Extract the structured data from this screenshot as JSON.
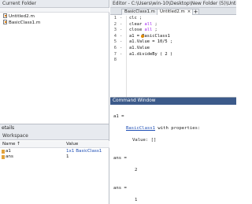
{
  "current_folder": {
    "title": "Current Folder",
    "files": [
      "Untitled2.m",
      "BasicClass1.m"
    ]
  },
  "details": {
    "label": "etails"
  },
  "workspace": {
    "title": "Workspace",
    "col_name": "Name ↑",
    "col_value": "Value",
    "vars": [
      {
        "name": "a1",
        "value": "1x1 BasicClass1"
      },
      {
        "name": "ans",
        "value": "1"
      }
    ]
  },
  "editor": {
    "title": "Editor - C:\\Users\\win-10\\Desktop\\New Folder (5)\\Untitled2.m",
    "tabs": [
      "BasicClass1.m",
      "Untitled2.m"
    ],
    "close_glyph": "×",
    "add_glyph": "+",
    "lines": [
      {
        "n": "1",
        "pre": "clc ;",
        "kw": "",
        "post": ""
      },
      {
        "n": "2",
        "pre": "clear ",
        "kw": "all",
        "post": " ;"
      },
      {
        "n": "3",
        "pre": "close ",
        "kw": "all",
        "post": " ;"
      },
      {
        "n": "4",
        "pre": "a1 = BasicClass1",
        "kw": "",
        "post": ""
      },
      {
        "n": "5",
        "pre": "a1.Value = 10/5 ;",
        "kw": "",
        "post": ""
      },
      {
        "n": "6",
        "pre": "a1.Value",
        "kw": "",
        "post": ""
      },
      {
        "n": "7",
        "pre": "a1.divideBy ( 2 )",
        "kw": "",
        "post": ""
      },
      {
        "n": "8",
        "pre": "",
        "kw": "",
        "post": ""
      }
    ],
    "dash": "-"
  },
  "command_window": {
    "title": "Command Window",
    "a1_line": "a1 =",
    "class_link": "BasicClass1",
    "props_suffix": " with properties:",
    "value_line": "Value: []",
    "ans1": "ans =",
    "ans1_val": "2",
    "ans2": "ans =",
    "ans2_val": "1"
  },
  "colors": {
    "keyword": "#a020f0",
    "link": "#1f4fb5",
    "cw_title": "#3c5a8a"
  }
}
